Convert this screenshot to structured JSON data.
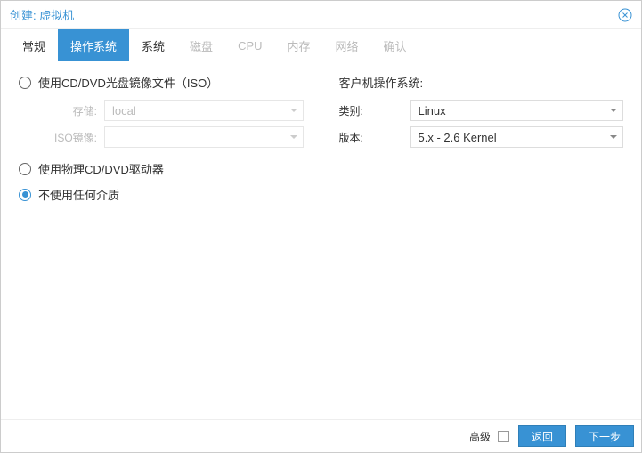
{
  "header": {
    "title": "创建: 虚拟机"
  },
  "tabs": [
    {
      "label": "常规",
      "state": "enabled"
    },
    {
      "label": "操作系统",
      "state": "active"
    },
    {
      "label": "系统",
      "state": "enabled"
    },
    {
      "label": "磁盘",
      "state": "disabled"
    },
    {
      "label": "CPU",
      "state": "disabled"
    },
    {
      "label": "内存",
      "state": "disabled"
    },
    {
      "label": "网络",
      "state": "disabled"
    },
    {
      "label": "确认",
      "state": "disabled"
    }
  ],
  "left": {
    "radio_iso": "使用CD/DVD光盘镜像文件（ISO）",
    "storage_label": "存储:",
    "storage_value": "local",
    "iso_label": "ISO镜像:",
    "iso_value": "",
    "radio_physical": "使用物理CD/DVD驱动器",
    "radio_none": "不使用任何介质"
  },
  "right": {
    "title": "客户机操作系统:",
    "type_label": "类别:",
    "type_value": "Linux",
    "version_label": "版本:",
    "version_value": "5.x - 2.6 Kernel"
  },
  "footer": {
    "advanced": "高级",
    "back": "返回",
    "next": "下一步"
  }
}
